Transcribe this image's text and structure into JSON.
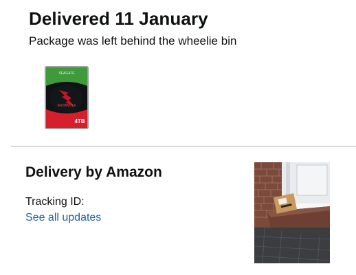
{
  "delivery": {
    "title": "Delivered 11 January",
    "subtitle": "Package was left behind the wheelie bin"
  },
  "product": {
    "image_icon": "hard-drive-icon",
    "brand_text": "SEAGATE",
    "model_text": "IRONWOLF",
    "capacity_text": "4TB"
  },
  "carrier": {
    "title": "Delivery by Amazon",
    "tracking_label": "Tracking ID:",
    "updates_link": "See all updates"
  },
  "colors": {
    "link": "#2162a1",
    "text": "#0f1111",
    "divider": "#d5d9d9"
  }
}
